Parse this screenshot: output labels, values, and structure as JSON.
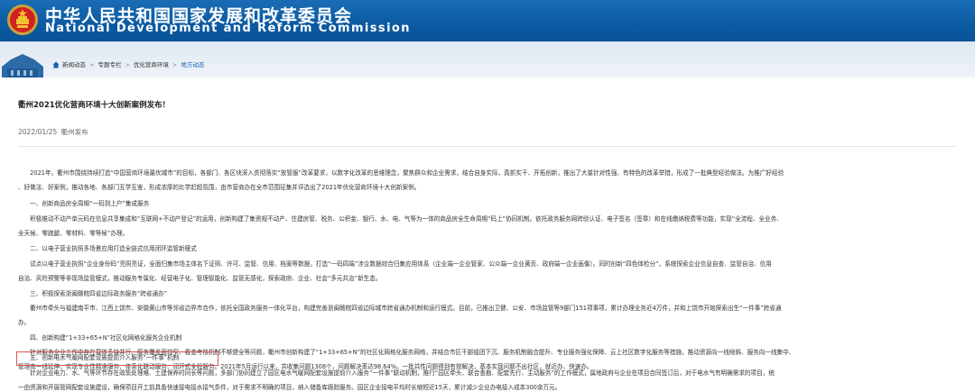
{
  "header": {
    "title_cn": "中华人民共和国国家发展和改革委员会",
    "title_en": "National Development and Reform Commission"
  },
  "breadcrumb": [
    "新闻动态",
    "专题专栏",
    "优化营商环境",
    "地方动态"
  ],
  "article": {
    "title": "衢州2021优化营商环境十大创新案例发布！",
    "date": "2022/01/25",
    "source": "衢州发布"
  },
  "body_lines": [
    "　　2021年，衢州市围绕持续打造“中国营商环境最优城市”的目标，各部门、各区块深入贯彻落实“放管服”改革要求，以数字化改革的思维理念，聚焦群众和企业需求，结合自身实际，真抓实干、开拓创新，推出了大量针对性强、有特色的改革举措，形成了一批典型经验做法。为推广好经验",
    "、好做法、好案例，推动各地、各部门互学互鉴，形成浓厚的比学赶超氛围，由市营商办在全市范围征集并评选出了2021年优化营商环境十大创新案例。",
    "　　一、创新商品房全周期“一码到上户”集成服务",
    "　　积极推动不动产单元码在信息共享集成和“互联网+不动产登记”的运用，创新构建了集资规不动产、住建房管、税务、公积金、银行、水、电、气等为一体的商品房全生命周期“码上”协同机制。依托政务服务网跨验认证、电子签名（签章）和在线缴纳税费等功能，实现“全流程、全业务、",
    "全天候、零跑腿、零材料、零等候”办理。",
    "　　二、以电子营业执照多场景应用打造全链式信用闭环监管新模式",
    "　　试点以电子营业执照“企业身份码”亮照亮证，全面归集市场主体名下证照、许可、监管、信用、档案等数据，打造“一码四端”涉企数据综合归集应用体系（企业端一企业管家、公众端一企业黄页、政府端一企业画像）。同时创新“四色体检分”，系统探索企业信息自查、监管自治、信用",
    "自治、风险预警等非现场监管模式，推动服务专属化、经营电子化、管理智能化、监管无感化，探索政府、企业、社会“多元共治”新生态。",
    "　　三、积极探索浙闽赣皖四省边际政务服务“跨省通办”",
    "　　衢州市牵头与福建南平市、江西上饶市、安徽黄山市等邻省边界市合作，依托全国政务服务一体化平台，构建完善浙闽赣皖四省边际城市跨省通办机制和运行模式。目前，已推出卫健、公安、市场监管等9部门151项事项，累计办理业务近4万件，并和上饶市开始探索出生“一件事”跨省通",
    "办。",
    "　　四、创新构建“1+33+65+N”社区化网格化服务企业机制",
    "　　针对服务企业工作中存在载体多缺并行、服务覆盖面较窄、看查考核机制不够健全等问题，衢州市创新构建了“1+33+65+N”的社区化网格化服务网络，并结合市区干部组团下沉、服务机制融合提升、专业服务强化保障、云上社区数字化服务等措施，推动资源向一线倾斜、服务向一线集中、",
    "管理向一线延伸，实现专业性精准服务、体系化联动服务、闭环式全程服务。2021年5月运行以来，共收集问题1308个，问题解决率达98.64%。一批共性问题得到有效解决，基本实现问题不出社区，就近办、快速办。",
    "　　五、创新电水气暖网配套设施提前介入服务“一件事”机制",
    "　　针对企业电力、水、气等环节存在政策处理难、土建保养时间长等问题，多部门协同建立了园区电水气暖网配套设施提前介入服务“一件事”联动机制，推行“园区牵头、联合查勘、配套先行、主动服务”的工作模式，属地政府与企业在项目合同签订后，对于电水气有明确需求的项目，统",
    "一由资源和开展管网配套设施建设，确保项目开工前具备快速接电接水接气条件，对于需求不明确的项目，纳入储备库跟踪服务。园区企业接电平均时长缩短近15天，累计减少企业办电接入成本300余万元。"
  ],
  "colors": {
    "header_blue": "#0b5aa2",
    "link_blue": "#1b5fb0",
    "highlight_border": "#e05555"
  }
}
